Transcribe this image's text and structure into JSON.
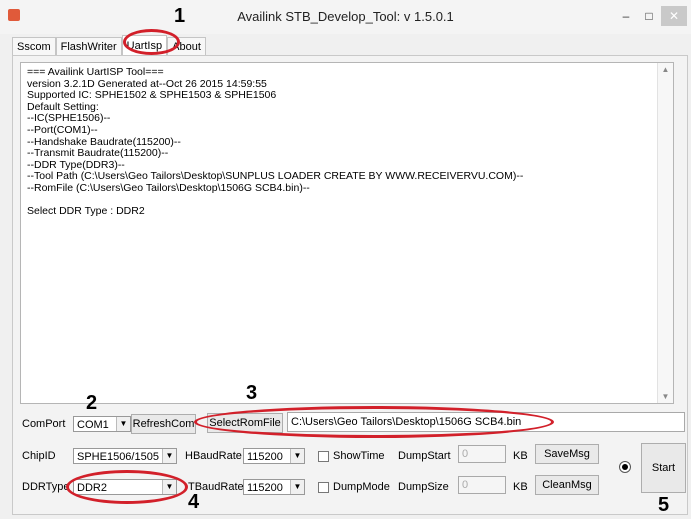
{
  "window": {
    "title": "Availink STB_Develop_Tool: v 1.5.0.1",
    "minimize": "–",
    "maximize": "□",
    "close": "✕"
  },
  "tabs": [
    {
      "label": "Sscom"
    },
    {
      "label": "FlashWriter"
    },
    {
      "label": "UartIsp"
    },
    {
      "label": "About"
    }
  ],
  "log": {
    "text": "=== Availink UartISP Tool===\nversion 3.2.1D Generated at--Oct 26 2015 14:59:55\nSupported IC: SPHE1502 & SPHE1503 & SPHE1506\nDefault Setting:\n--IC(SPHE1506)--\n--Port(COM1)--\n--Handshake Baudrate(115200)--\n--Transmit Baudrate(115200)--\n--DDR Type(DDR3)--\n--Tool Path (C:\\Users\\Geo Tailors\\Desktop\\SUNPLUS LOADER CREATE BY WWW.RECEIVERVU.COM)--\n--RomFile (C:\\Users\\Geo Tailors\\Desktop\\1506G SCB4.bin)--\n\nSelect DDR Type : DDR2"
  },
  "controls": {
    "comport_label": "ComPort",
    "comport_value": "COM1",
    "refresh_label": "RefreshCom",
    "select_rom_label": "SelectRomFile",
    "rom_path": "C:\\Users\\Geo Tailors\\Desktop\\1506G SCB4.bin",
    "chipid_label": "ChipID",
    "chipid_value": "SPHE1506/1505",
    "hbaud_label": "HBaudRate",
    "hbaud_value": "115200",
    "showtime_label": "ShowTime",
    "dumpstart_label": "DumpStart",
    "dumpstart_value": "0",
    "kb1": "KB",
    "savemsg_label": "SaveMsg",
    "ddrtype_label": "DDRType",
    "ddrtype_value": "DDR2",
    "tbaud_label": "TBaudRate",
    "tbaud_value": "115200",
    "dumpmode_label": "DumpMode",
    "dumpsize_label": "DumpSize",
    "dumpsize_value": "0",
    "kb2": "KB",
    "cleanmsg_label": "CleanMsg",
    "start_label": "Start"
  },
  "annotations": {
    "n1": "1",
    "n2": "2",
    "n3": "3",
    "n4": "4",
    "n5": "5"
  },
  "colors": {
    "highlight": "#d2202a"
  }
}
